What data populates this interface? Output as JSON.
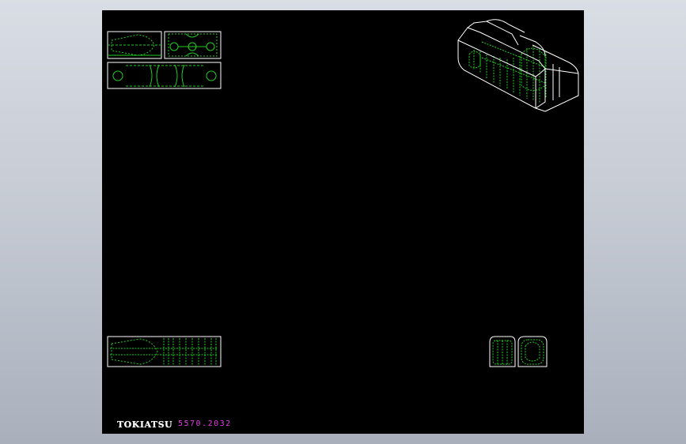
{
  "title_block": {
    "brand": "TOKIATSU",
    "part_number": "5570.2032"
  },
  "colors": {
    "background_gradient_top": "#d9dde4",
    "background_gradient_bottom": "#a9b0bc",
    "canvas": "#000000",
    "outline": "#ffffff",
    "hidden_lines": "#22cc22",
    "part_number_text": "#e040e0"
  }
}
